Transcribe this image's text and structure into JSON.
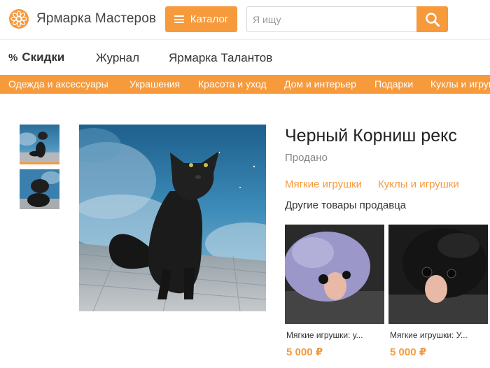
{
  "brand": {
    "name": "Ярмарка Мастеров",
    "logo_icon": "sun-flower-logo"
  },
  "header": {
    "catalog_label": "Каталог",
    "search_placeholder": "Я ищу",
    "search_value": ""
  },
  "subnav": {
    "sale_label": "Скидки",
    "sale_icon": "%",
    "journal_label": "Журнал",
    "talents_label": "Ярмарка Талантов"
  },
  "categories": [
    "Одежда и аксессуары",
    "Украшения",
    "Красота и уход",
    "Дом и интерьер",
    "Подарки",
    "Куклы и игрушки"
  ],
  "product": {
    "title": "Черный Корниш рекс",
    "status": "Продано",
    "tags": [
      "Мягкие игрушки",
      "Куклы и игрушки"
    ],
    "other_title": "Другие товары продавца"
  },
  "related": [
    {
      "name": "Мягкие игрушки: у...",
      "price": "5 000 ₽"
    },
    {
      "name": "Мягкие игрушки: У...",
      "price": "5 000 ₽"
    }
  ],
  "colors": {
    "accent": "#f69a3c",
    "text": "#333333",
    "muted": "#888888"
  }
}
